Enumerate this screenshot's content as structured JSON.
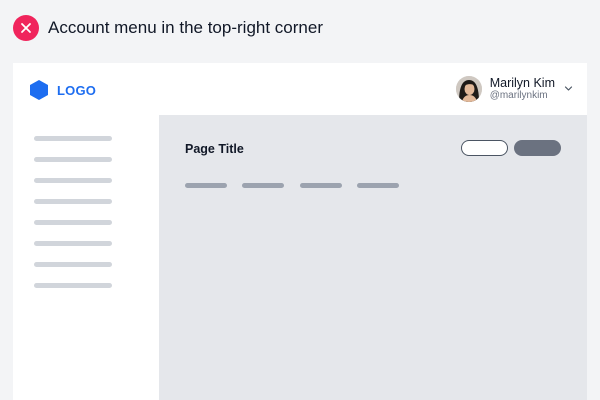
{
  "caption": {
    "icon": "close-circle-icon",
    "icon_color": "#f0245c",
    "text": "Account menu in the top-right corner"
  },
  "header": {
    "logo": {
      "icon": "hexagon-icon",
      "text": "LOGO",
      "color": "#1d6df0"
    },
    "account": {
      "name": "Marilyn Kim",
      "handle": "@marilynkim",
      "avatar_icon": "avatar-photo",
      "chevron_icon": "chevron-down-icon"
    }
  },
  "sidebar": {
    "item_count": 8
  },
  "main": {
    "page_title": "Page Title",
    "tab_count": 4
  },
  "colors": {
    "page_background": "#f3f4f6",
    "main_background": "#e5e7eb",
    "placeholder_line": "#d1d5db",
    "tab_line": "#9ca3af",
    "filled_button": "#6b7280"
  }
}
